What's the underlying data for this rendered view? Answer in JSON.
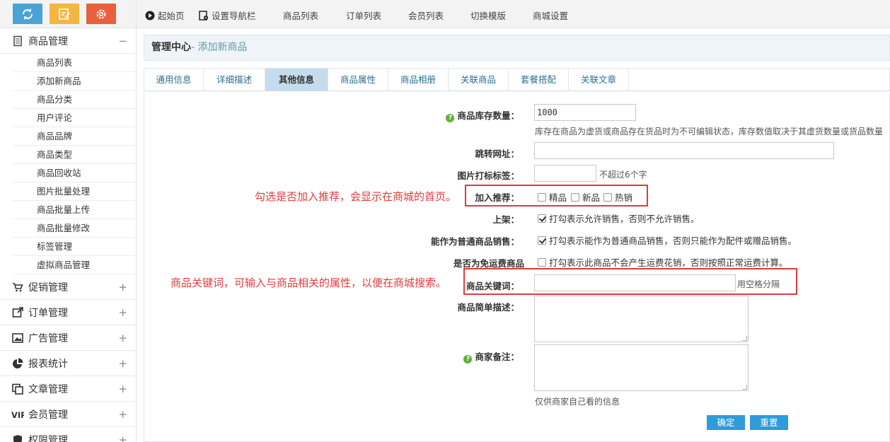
{
  "sidebar": {
    "groups": [
      {
        "label": "商品管理",
        "toggle": "−"
      },
      {
        "label": "促销管理",
        "toggle": "+"
      },
      {
        "label": "订单管理",
        "toggle": "+"
      },
      {
        "label": "广告管理",
        "toggle": "+"
      },
      {
        "label": "报表统计",
        "toggle": "+"
      },
      {
        "label": "文章管理",
        "toggle": "+"
      },
      {
        "label": "会员管理",
        "toggle": "+"
      },
      {
        "label": "权限管理",
        "toggle": "+"
      }
    ],
    "goods_items": [
      "商品列表",
      "添加新商品",
      "商品分类",
      "用户评论",
      "商品品牌",
      "商品类型",
      "商品回收站",
      "图片批量处理",
      "商品批量上传",
      "商品批量修改",
      "标签管理",
      "虚拟商品管理"
    ]
  },
  "topnav": [
    "起始页",
    "设置导航栏",
    "商品列表",
    "订单列表",
    "会员列表",
    "切换模版",
    "商城设置"
  ],
  "header": {
    "title": "管理中心",
    "subtitle": "- 添加新商品"
  },
  "tabs": [
    "通用信息",
    "详细描述",
    "其他信息",
    "商品属性",
    "商品相册",
    "关联商品",
    "套餐搭配",
    "关联文章"
  ],
  "form": {
    "stock_label": "商品库存数量：",
    "stock_value": "1000",
    "stock_note": "库存在商品为虚货或商品存在货品时为不可编辑状态，库存数值取决于其虚货数量或货品数量",
    "url_label": "跳转网址：",
    "tag_label": "图片打标标签：",
    "tag_note": "不超过6个字",
    "recommend_label": "加入推荐：",
    "recommend_opts": [
      "精品",
      "新品",
      "热销"
    ],
    "onsale_label": "上架：",
    "onsale_note": "打勾表示允许销售，否则不允许销售。",
    "normal_label": "能作为普通商品销售：",
    "normal_note": "打勾表示能作为普通商品销售，否则只能作为配件或赠品销售。",
    "freeship_label": "是否为免运费商品",
    "freeship_note": "打勾表示此商品不会产生运费花销，否则按照正常运费计算。",
    "keywords_label": "商品关键词：",
    "keywords_note": "用空格分隔",
    "brief_label": "商品简单描述：",
    "remark_label": "商家备注：",
    "remark_note": "仅供商家自己看的信息",
    "confirm": "确定",
    "reset": "重置"
  },
  "annotations": {
    "recommend": "勾选是否加入推荐，会显示在商城的首页。",
    "keywords": "商品关键词，可输入与商品相关的属性，以便在商城搜索。"
  }
}
